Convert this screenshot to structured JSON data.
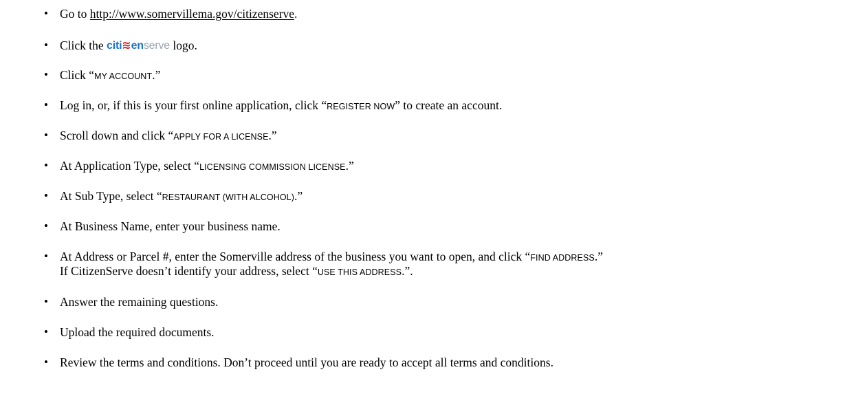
{
  "steps": [
    {
      "pre": "Go to ",
      "link": "http://www.somervillema.gov/citizenserve",
      "post": "."
    },
    {
      "pre": "Click the ",
      "logo": {
        "a": "citi",
        "b": "≋",
        "c": "en",
        "d": "serve"
      },
      "post": " logo."
    },
    {
      "pre": "Click “",
      "sc": "MY ACCOUNT",
      "post": ".”"
    },
    {
      "pre": "Log in, or, if this is your first online application, click “",
      "sc": "REGISTER NOW",
      "post": "” to create an account."
    },
    {
      "pre": "Scroll down and click “",
      "sc": "APPLY FOR A LICENSE",
      "post": ".”"
    },
    {
      "pre": "At Application Type, select “",
      "sc": "LICENSING COMMISSION LICENSE",
      "post": ".”"
    },
    {
      "pre": "At Sub Type, select “",
      "sc": "RESTAURANT (WITH ALCOHOL)",
      "post": ".”"
    },
    {
      "text": "At Business Name, enter your business name."
    },
    {
      "pre": "At Address or Parcel #, enter the Somerville address of the business you want to open, and click “",
      "sc": "FIND ADDRESS",
      "post": ".”",
      "line2_pre": "If CitizenServe doesn’t identify your address, select “",
      "line2_sc": "USE THIS ADDRESS",
      "line2_post": ".”."
    },
    {
      "text": "Answer the remaining questions."
    },
    {
      "text": "Upload the required documents."
    },
    {
      "text": "Review the terms and conditions. Don’t proceed until you are ready to accept all terms and conditions."
    }
  ],
  "bullet_glyph": "•",
  "colors": {
    "logo_blue": "#1b75c9",
    "logo_red": "#d81e27",
    "logo_gray": "#9aa3ad"
  }
}
